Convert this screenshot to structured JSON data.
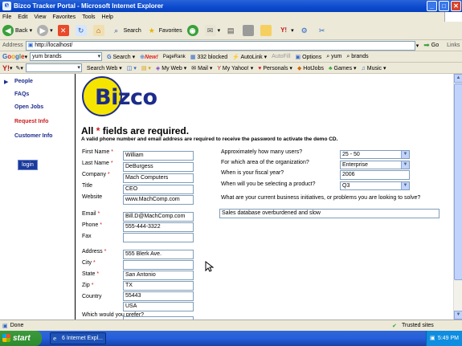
{
  "window": {
    "title": "Bizco Tracker Portal - Microsoft Internet Explorer"
  },
  "menu": [
    "File",
    "Edit",
    "View",
    "Favorites",
    "Tools",
    "Help"
  ],
  "toolbar": {
    "back_label": "Back",
    "search_label": "Search",
    "favorites_label": "Favorites"
  },
  "address": {
    "label": "Address",
    "value": "http://localhost/",
    "go_label": "Go",
    "links_label": "Links"
  },
  "googlebar": {
    "search_value": "yum brands",
    "search_button": "Search",
    "new_badge": "New!",
    "pagerank_label": "PageRank",
    "blocked_label": "332 blocked",
    "autolink_label": "AutoLink",
    "autofill_label": "AutoFill",
    "options_label": "Options",
    "term1": "yum",
    "term2": "brands"
  },
  "yahoobar": {
    "search_web_label": "Search Web",
    "my_web_label": "My Web",
    "mail_label": "Mail",
    "my_yahoo_label": "My Yahoo!",
    "personals_label": "Personals",
    "hotjobs_label": "HotJobs",
    "games_label": "Games",
    "music_label": "Music"
  },
  "sidebar": {
    "items": [
      "People",
      "FAQs",
      "Open Jobs",
      "Request Info",
      "Customer Info"
    ],
    "login_label": "login"
  },
  "page": {
    "logo_text": "Bizco",
    "required_prefix": "All",
    "required_star": "*",
    "required_suffix": "fields are required.",
    "subtitle": "A valid phone number and email address are required to receive the password to activate the demo CD."
  },
  "form": {
    "first_name": {
      "label": "First Name",
      "value": "William"
    },
    "last_name": {
      "label": "Last Name",
      "value": "DeBurgess"
    },
    "company": {
      "label": "Company",
      "value": "Mach Computers"
    },
    "title": {
      "label": "Title",
      "value": "CEO"
    },
    "website": {
      "label": "Website",
      "value": "www.MachComp.com"
    },
    "email": {
      "label": "Email",
      "value": "Bill.D@MachComp.com"
    },
    "phone": {
      "label": "Phone",
      "value": "555-444-3322"
    },
    "fax": {
      "label": "Fax",
      "value": ""
    },
    "address": {
      "label": "Address",
      "value": "555 Blerk Ave."
    },
    "address2": {
      "value": ""
    },
    "city": {
      "label": "City",
      "value": "San Antonio"
    },
    "state": {
      "label": "State",
      "value": "TX"
    },
    "zip": {
      "label": "Zip",
      "value": "55443"
    },
    "country": {
      "label": "Country",
      "value": "USA"
    },
    "prefer_label": "Which would you prefer?",
    "users_q": {
      "label": "Approximately how many users?",
      "value": "25 - 50"
    },
    "area_q": {
      "label": "For which area of the organization?",
      "value": "Enterprise"
    },
    "fiscal_q": {
      "label": "When is your fiscal year?",
      "value": "2006"
    },
    "product_q": {
      "label": "When will you be selecting a product?",
      "value": "Q3"
    },
    "initiatives_q": {
      "label": "What are your current business initiatives, or problems you are looking to solve?",
      "value": "Sales database overburdened and slow"
    }
  },
  "statusbar": {
    "status": "Done",
    "zone": "Trusted sites"
  },
  "taskbar": {
    "start_label": "start",
    "task_label": "6 Internet Expl...",
    "clock": "5:49 PM"
  }
}
